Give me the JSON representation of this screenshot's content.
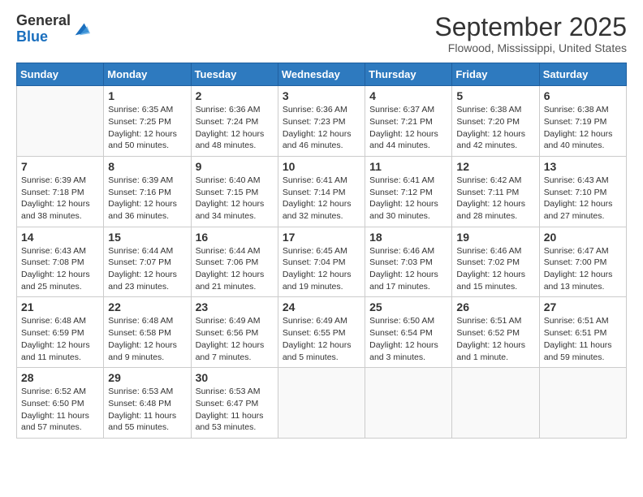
{
  "header": {
    "logo_line1": "General",
    "logo_line2": "Blue",
    "month_title": "September 2025",
    "location": "Flowood, Mississippi, United States"
  },
  "days_of_week": [
    "Sunday",
    "Monday",
    "Tuesday",
    "Wednesday",
    "Thursday",
    "Friday",
    "Saturday"
  ],
  "weeks": [
    [
      {
        "day": "",
        "info": ""
      },
      {
        "day": "1",
        "info": "Sunrise: 6:35 AM\nSunset: 7:25 PM\nDaylight: 12 hours\nand 50 minutes."
      },
      {
        "day": "2",
        "info": "Sunrise: 6:36 AM\nSunset: 7:24 PM\nDaylight: 12 hours\nand 48 minutes."
      },
      {
        "day": "3",
        "info": "Sunrise: 6:36 AM\nSunset: 7:23 PM\nDaylight: 12 hours\nand 46 minutes."
      },
      {
        "day": "4",
        "info": "Sunrise: 6:37 AM\nSunset: 7:21 PM\nDaylight: 12 hours\nand 44 minutes."
      },
      {
        "day": "5",
        "info": "Sunrise: 6:38 AM\nSunset: 7:20 PM\nDaylight: 12 hours\nand 42 minutes."
      },
      {
        "day": "6",
        "info": "Sunrise: 6:38 AM\nSunset: 7:19 PM\nDaylight: 12 hours\nand 40 minutes."
      }
    ],
    [
      {
        "day": "7",
        "info": "Sunrise: 6:39 AM\nSunset: 7:18 PM\nDaylight: 12 hours\nand 38 minutes."
      },
      {
        "day": "8",
        "info": "Sunrise: 6:39 AM\nSunset: 7:16 PM\nDaylight: 12 hours\nand 36 minutes."
      },
      {
        "day": "9",
        "info": "Sunrise: 6:40 AM\nSunset: 7:15 PM\nDaylight: 12 hours\nand 34 minutes."
      },
      {
        "day": "10",
        "info": "Sunrise: 6:41 AM\nSunset: 7:14 PM\nDaylight: 12 hours\nand 32 minutes."
      },
      {
        "day": "11",
        "info": "Sunrise: 6:41 AM\nSunset: 7:12 PM\nDaylight: 12 hours\nand 30 minutes."
      },
      {
        "day": "12",
        "info": "Sunrise: 6:42 AM\nSunset: 7:11 PM\nDaylight: 12 hours\nand 28 minutes."
      },
      {
        "day": "13",
        "info": "Sunrise: 6:43 AM\nSunset: 7:10 PM\nDaylight: 12 hours\nand 27 minutes."
      }
    ],
    [
      {
        "day": "14",
        "info": "Sunrise: 6:43 AM\nSunset: 7:08 PM\nDaylight: 12 hours\nand 25 minutes."
      },
      {
        "day": "15",
        "info": "Sunrise: 6:44 AM\nSunset: 7:07 PM\nDaylight: 12 hours\nand 23 minutes."
      },
      {
        "day": "16",
        "info": "Sunrise: 6:44 AM\nSunset: 7:06 PM\nDaylight: 12 hours\nand 21 minutes."
      },
      {
        "day": "17",
        "info": "Sunrise: 6:45 AM\nSunset: 7:04 PM\nDaylight: 12 hours\nand 19 minutes."
      },
      {
        "day": "18",
        "info": "Sunrise: 6:46 AM\nSunset: 7:03 PM\nDaylight: 12 hours\nand 17 minutes."
      },
      {
        "day": "19",
        "info": "Sunrise: 6:46 AM\nSunset: 7:02 PM\nDaylight: 12 hours\nand 15 minutes."
      },
      {
        "day": "20",
        "info": "Sunrise: 6:47 AM\nSunset: 7:00 PM\nDaylight: 12 hours\nand 13 minutes."
      }
    ],
    [
      {
        "day": "21",
        "info": "Sunrise: 6:48 AM\nSunset: 6:59 PM\nDaylight: 12 hours\nand 11 minutes."
      },
      {
        "day": "22",
        "info": "Sunrise: 6:48 AM\nSunset: 6:58 PM\nDaylight: 12 hours\nand 9 minutes."
      },
      {
        "day": "23",
        "info": "Sunrise: 6:49 AM\nSunset: 6:56 PM\nDaylight: 12 hours\nand 7 minutes."
      },
      {
        "day": "24",
        "info": "Sunrise: 6:49 AM\nSunset: 6:55 PM\nDaylight: 12 hours\nand 5 minutes."
      },
      {
        "day": "25",
        "info": "Sunrise: 6:50 AM\nSunset: 6:54 PM\nDaylight: 12 hours\nand 3 minutes."
      },
      {
        "day": "26",
        "info": "Sunrise: 6:51 AM\nSunset: 6:52 PM\nDaylight: 12 hours\nand 1 minute."
      },
      {
        "day": "27",
        "info": "Sunrise: 6:51 AM\nSunset: 6:51 PM\nDaylight: 11 hours\nand 59 minutes."
      }
    ],
    [
      {
        "day": "28",
        "info": "Sunrise: 6:52 AM\nSunset: 6:50 PM\nDaylight: 11 hours\nand 57 minutes."
      },
      {
        "day": "29",
        "info": "Sunrise: 6:53 AM\nSunset: 6:48 PM\nDaylight: 11 hours\nand 55 minutes."
      },
      {
        "day": "30",
        "info": "Sunrise: 6:53 AM\nSunset: 6:47 PM\nDaylight: 11 hours\nand 53 minutes."
      },
      {
        "day": "",
        "info": ""
      },
      {
        "day": "",
        "info": ""
      },
      {
        "day": "",
        "info": ""
      },
      {
        "day": "",
        "info": ""
      }
    ]
  ]
}
